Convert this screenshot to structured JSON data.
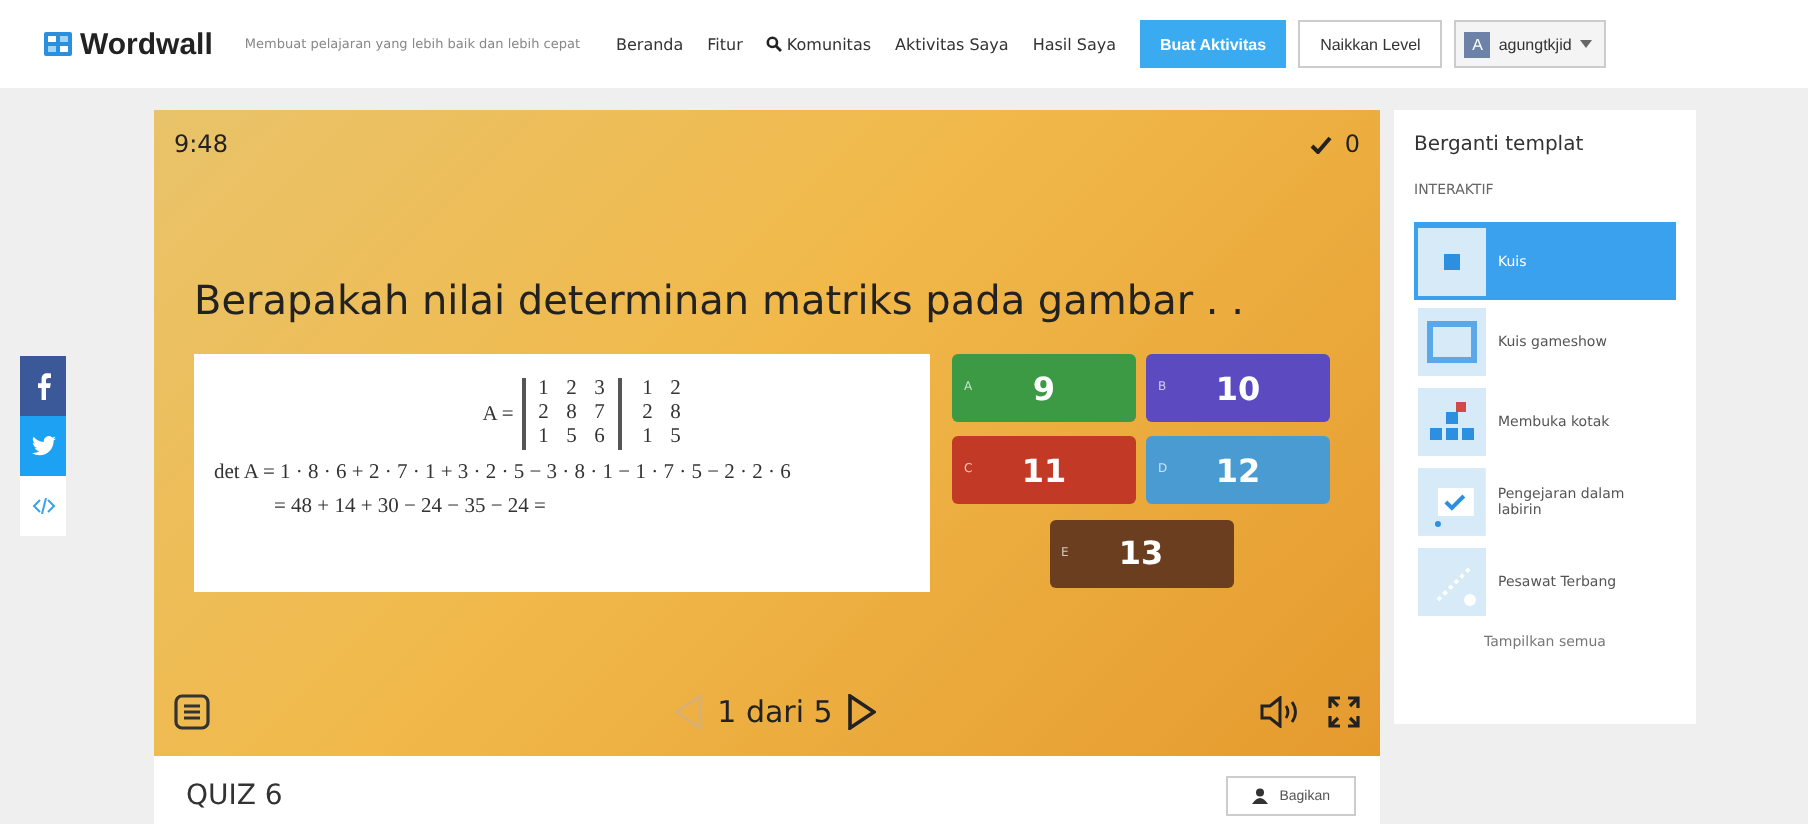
{
  "header": {
    "logo": "Wordwall",
    "tagline": "Membuat pelajaran yang lebih baik dan lebih cepat",
    "nav": [
      {
        "label": "Beranda",
        "kind": "plain"
      },
      {
        "label": "Fitur",
        "kind": "plain"
      },
      {
        "label": "Komunitas",
        "kind": "search"
      },
      {
        "label": "Aktivitas Saya",
        "kind": "plain"
      },
      {
        "label": "Hasil Saya",
        "kind": "plain"
      }
    ],
    "create_button": "Buat Aktivitas",
    "upgrade_button": "Naikkan Level",
    "user": {
      "initial": "A",
      "name": "agungtkjid"
    }
  },
  "game": {
    "timer": "9:48",
    "score": "0",
    "question": "Berapakah nilai determinan matriks pada gambar . .",
    "image": {
      "matrix_label": "A =",
      "rows": [
        [
          "1",
          "2",
          "3",
          "1",
          "2"
        ],
        [
          "2",
          "8",
          "7",
          "2",
          "8"
        ],
        [
          "1",
          "5",
          "6",
          "1",
          "5"
        ]
      ],
      "det_line": "det A = 1 · 8 · 6 + 2 · 7 · 1 + 3 · 2 · 5 − 3 · 8 · 1 − 1 · 7 · 5 − 2 · 2 · 6",
      "result_line": "= 48 + 14 + 30 − 24 − 35 − 24 ="
    },
    "answers": [
      {
        "letter": "A",
        "text": "9",
        "color": "#3b9a43"
      },
      {
        "letter": "B",
        "text": "10",
        "color": "#5b4ac0"
      },
      {
        "letter": "C",
        "text": "11",
        "color": "#c23a26"
      },
      {
        "letter": "D",
        "text": "12",
        "color": "#4b9bd3"
      },
      {
        "letter": "E",
        "text": "13",
        "color": "#6a3e1f"
      }
    ],
    "pager": {
      "text": "1 dari 5",
      "prev_disabled": true,
      "next_disabled": false
    }
  },
  "quiz_title": "QUIZ 6",
  "share_button": "Bagikan",
  "sidebar": {
    "title": "Berganti templat",
    "section": "INTERAKTIF",
    "templates": [
      {
        "label": "Kuis",
        "selected": true
      },
      {
        "label": "Kuis gameshow",
        "selected": false
      },
      {
        "label": "Membuka kotak",
        "selected": false
      },
      {
        "label": "Pengejaran dalam labirin",
        "selected": false
      },
      {
        "label": "Pesawat Terbang",
        "selected": false
      }
    ],
    "show_all": "Tampilkan semua"
  }
}
